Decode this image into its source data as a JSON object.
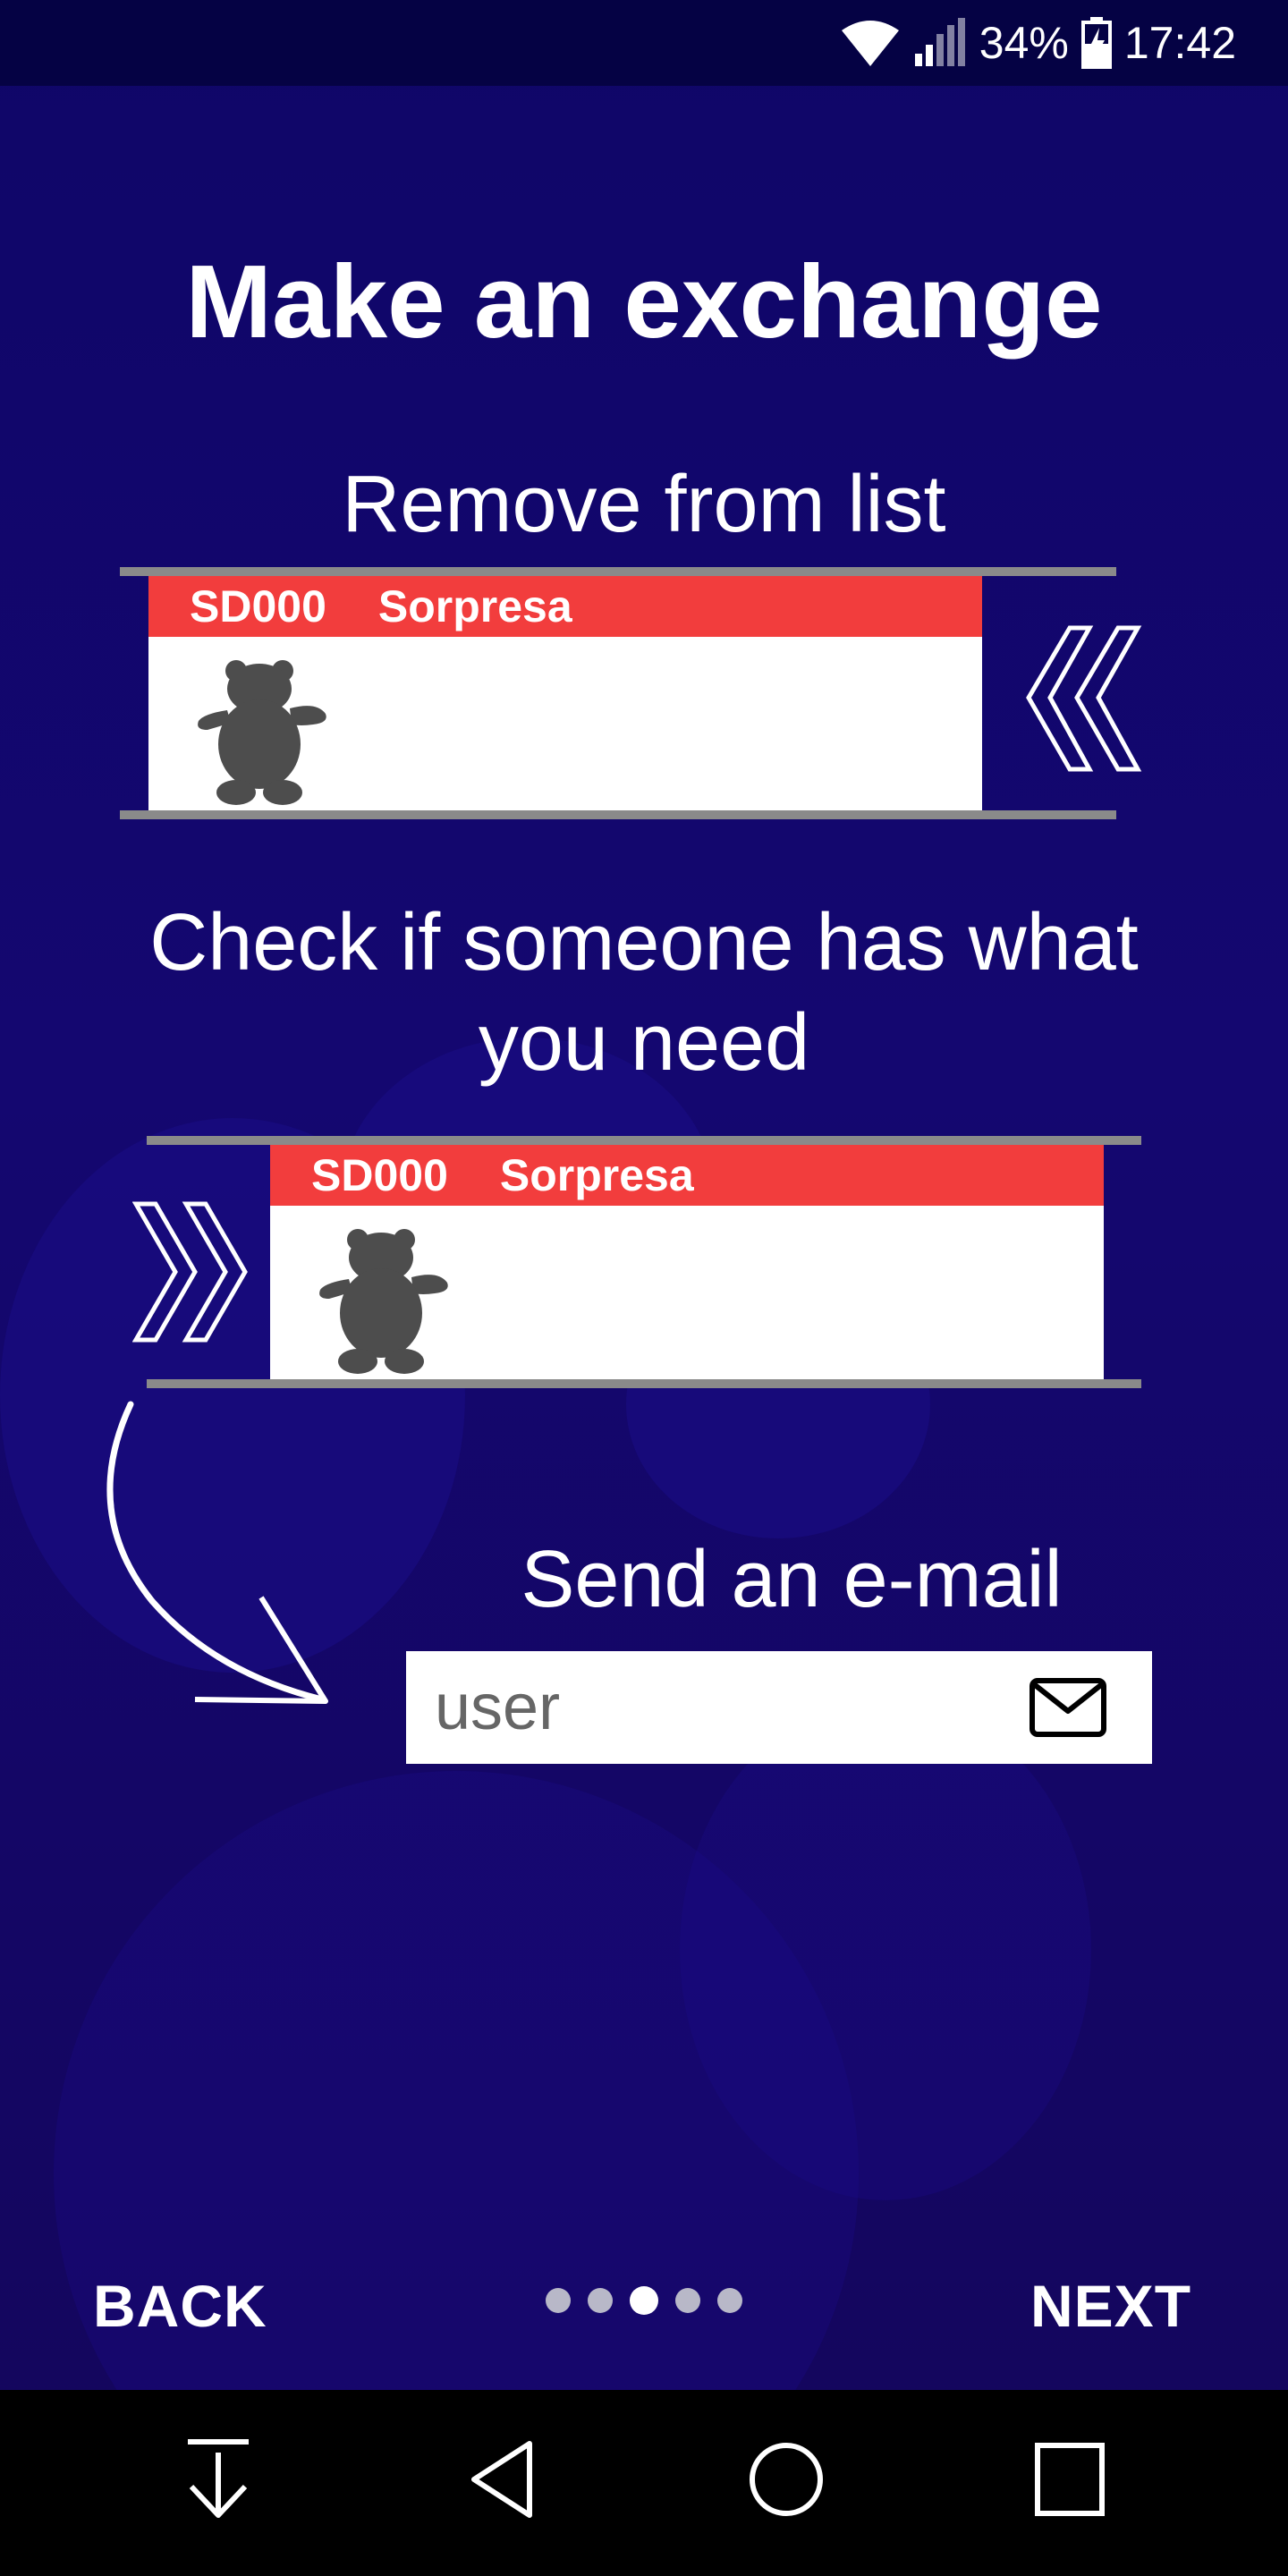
{
  "status_bar": {
    "battery": "34%",
    "time": "17:42"
  },
  "title": "Make an exchange",
  "sections": {
    "remove": {
      "heading": "Remove from list",
      "card": {
        "code": "SD000",
        "name": "Sorpresa"
      }
    },
    "check": {
      "heading_line1": "Check if someone has what",
      "heading_line2": "you need",
      "card": {
        "code": "SD000",
        "name": "Sorpresa"
      }
    },
    "email": {
      "heading": "Send an e-mail",
      "field_value": "user"
    }
  },
  "pager": {
    "back_label": "BACK",
    "next_label": "NEXT",
    "page_count": 5,
    "current_page": 3
  },
  "system_nav": {
    "buttons": [
      "download-icon",
      "back-triangle-icon",
      "home-circle-icon",
      "recents-square-icon"
    ]
  }
}
